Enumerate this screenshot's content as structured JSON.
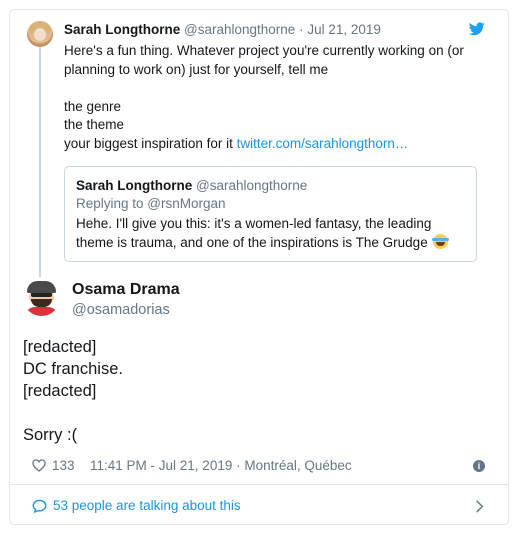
{
  "quoted_thread": {
    "author_name": "Sarah Longthorne",
    "author_handle": "@sarahlongthorne",
    "date_sep": " · ",
    "date": "Jul 21, 2019",
    "body_lines": [
      "Here's a fun thing. Whatever project you're currently working on (or",
      "planning to work on) just for yourself, tell me"
    ],
    "list_lines": [
      "the genre",
      "the theme"
    ],
    "last_line_prefix": "your biggest inspiration for it ",
    "link_text": "twitter.com/sarahlongthorn…"
  },
  "embedded_quote": {
    "author_name": "Sarah Longthorne",
    "author_handle": "@sarahlongthorne",
    "replying_prefix": "Replying to ",
    "replying_handle": "@rsnMorgan",
    "text_line1": "Hehe. I'll give you this: it's a women-led fantasy, the leading",
    "text_line2": "theme is trauma, and one of the inspirations is The Grudge",
    "emoji": "joy-emoji"
  },
  "main_tweet": {
    "author_name": "Osama Drama",
    "author_handle": "@osamadorias",
    "lines": [
      "[redacted]",
      "DC franchise.",
      "[redacted]",
      "",
      "Sorry :("
    ],
    "likes": "133",
    "timestamp": "11:41 PM - Jul 21, 2019 · Montréal, Québec"
  },
  "footer": {
    "talking_text": "53 people are talking about this"
  },
  "icons": {
    "bird": "twitter-bird-icon",
    "heart": "heart-icon",
    "info": "info-icon",
    "bubble": "speech-bubble-icon",
    "chevron": "chevron-right-icon"
  },
  "colors": {
    "link": "#1b95e0",
    "muted": "#657786",
    "text": "#14171a",
    "border": "#e1e8ed"
  }
}
